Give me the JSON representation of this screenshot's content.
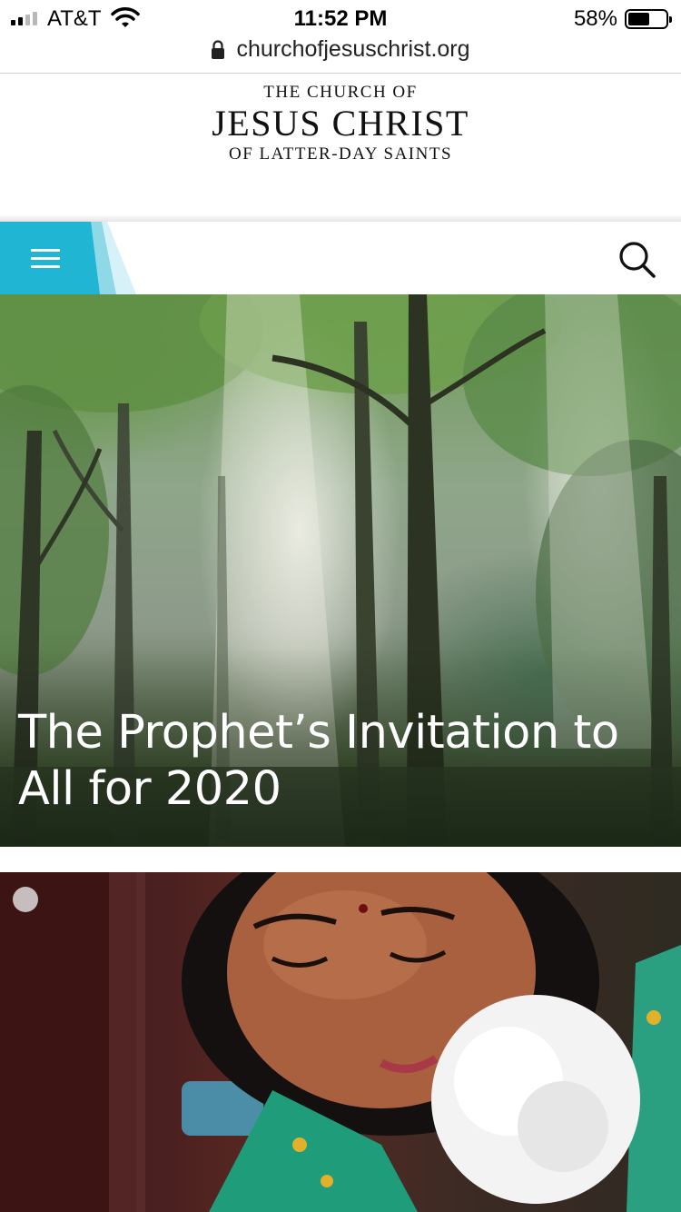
{
  "status": {
    "carrier": "AT&T",
    "time": "11:52 PM",
    "battery_percent": "58%",
    "battery_level": 0.58
  },
  "browser": {
    "url": "churchofjesuschrist.org"
  },
  "logo": {
    "line1": "THE CHURCH OF",
    "line2": "JESUS CHRIST",
    "line3": "OF LATTER-DAY SAINTS"
  },
  "nav": {
    "accent_color": "#1fb5d3",
    "menu_icon": "hamburger-menu-icon",
    "search_icon": "search-icon"
  },
  "hero": {
    "title": "The Prophet’s Invitation to All for 2020"
  }
}
